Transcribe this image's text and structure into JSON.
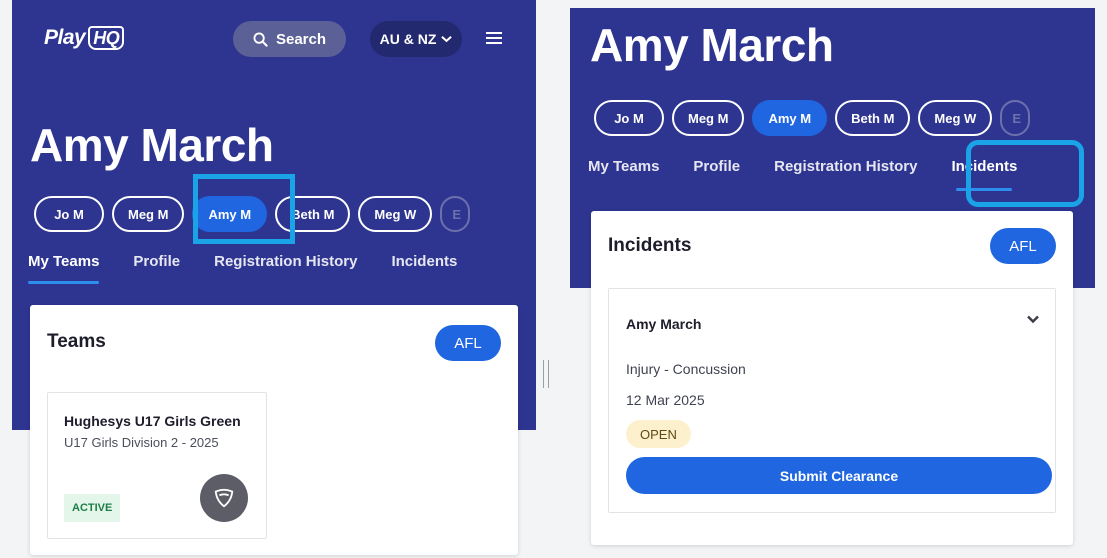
{
  "header": {
    "logo_play": "Play",
    "logo_hq": "HQ",
    "search_label": "Search",
    "region_label": "AU & NZ"
  },
  "profile": {
    "name": "Amy March",
    "chips": [
      "Jo M",
      "Meg M",
      "Amy M",
      "Beth M",
      "Meg W",
      "E"
    ],
    "active_chip": "Amy M",
    "tabs": [
      "My Teams",
      "Profile",
      "Registration History",
      "Incidents"
    ]
  },
  "teams_panel": {
    "heading": "Teams",
    "sport": "AFL",
    "team": {
      "name": "Hughesys U17 Girls Green",
      "division": "U17 Girls Division 2 - 2025",
      "status": "ACTIVE"
    }
  },
  "incidents_panel": {
    "heading": "Incidents",
    "sport": "AFL",
    "incident": {
      "person": "Amy March",
      "type": "Injury - Concussion",
      "date": "12 Mar 2025",
      "status": "OPEN",
      "action_label": "Submit Clearance"
    }
  },
  "colors": {
    "brand_navy": "#2e3591",
    "accent_blue": "#1f66e0",
    "highlight_cyan": "#1aa3e6",
    "active_badge_bg": "#e4f6ea",
    "open_badge_bg": "#fdf0cd"
  }
}
